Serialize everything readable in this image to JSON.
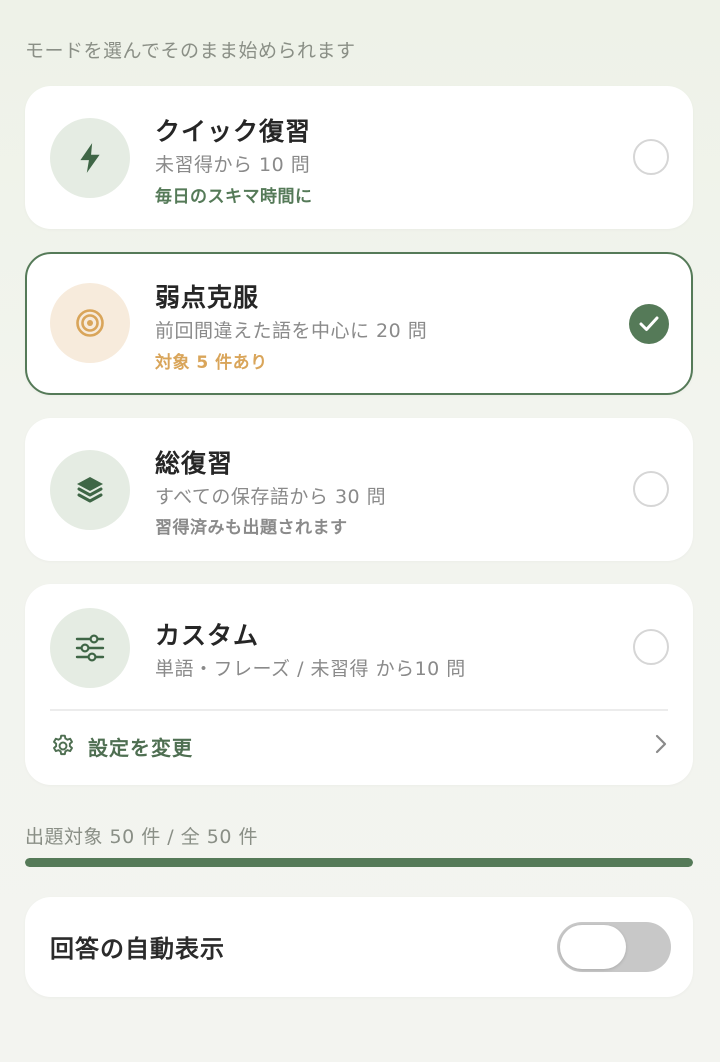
{
  "subtitle": "モードを選んでそのまま始められます",
  "modes": [
    {
      "title": "クイック復習",
      "desc": "未習得から 10 問",
      "note": "毎日のスキマ時間に",
      "note_color": "#557a58",
      "icon": "lightning-icon",
      "selected": false
    },
    {
      "title": "弱点克服",
      "desc": "前回間違えた語を中心に 20 問",
      "note": "対象 5 件あり",
      "note_color": "#d9a55a",
      "icon": "target-icon",
      "selected": true
    },
    {
      "title": "総復習",
      "desc": "すべての保存語から 30 問",
      "note": "習得済みも出題されます",
      "note_color": "#8a8a8a",
      "icon": "layers-icon",
      "selected": false
    },
    {
      "title": "カスタム",
      "desc": "単語・フレーズ / 未習得 から10 問",
      "icon": "sliders-icon",
      "selected": false,
      "settings_label": "設定を変更"
    }
  ],
  "question_count": {
    "text": "出題対象 50 件 / 全 50 件",
    "fraction": 1.0
  },
  "auto_show": {
    "label": "回答の自動表示",
    "enabled": false
  },
  "colors": {
    "accent": "#557a58",
    "warning": "#d9a55a"
  }
}
